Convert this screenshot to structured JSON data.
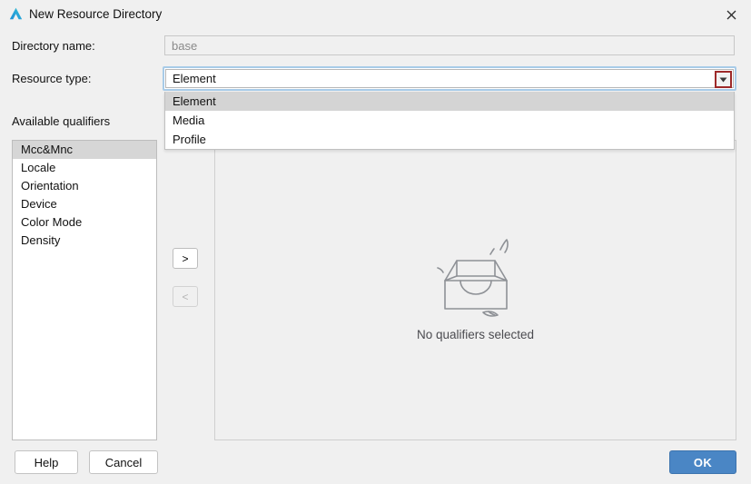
{
  "window": {
    "title": "New Resource Directory",
    "icon": "app-logo-icon",
    "close_label": "✕"
  },
  "form": {
    "directory_name_label": "Directory name:",
    "directory_name_value": "base",
    "directory_name_placeholder": "base",
    "resource_type_label": "Resource type:",
    "resource_type_value": "Element"
  },
  "dropdown": {
    "open": true,
    "options": [
      {
        "label": "Element",
        "selected": true
      },
      {
        "label": "Media",
        "selected": false
      },
      {
        "label": "Profile",
        "selected": false
      }
    ]
  },
  "qualifiers": {
    "available_label": "Available qualifiers",
    "items": [
      {
        "label": "Mcc&Mnc",
        "selected": true
      },
      {
        "label": "Locale",
        "selected": false
      },
      {
        "label": "Orientation",
        "selected": false
      },
      {
        "label": "Device",
        "selected": false
      },
      {
        "label": "Color Mode",
        "selected": false
      },
      {
        "label": "Density",
        "selected": false
      }
    ]
  },
  "transfer": {
    "add_label": ">",
    "remove_label": "<"
  },
  "chosen": {
    "empty_text": "No qualifiers selected",
    "empty_icon": "empty-box-icon"
  },
  "footer": {
    "help_label": "Help",
    "cancel_label": "Cancel",
    "ok_label": "OK"
  },
  "colors": {
    "background": "#f0f0f0",
    "accent": "#4a86c5",
    "focus_ring": "#a8cbe8",
    "highlight_outline": "#9e2a2a",
    "selection": "#d6d6d6"
  }
}
